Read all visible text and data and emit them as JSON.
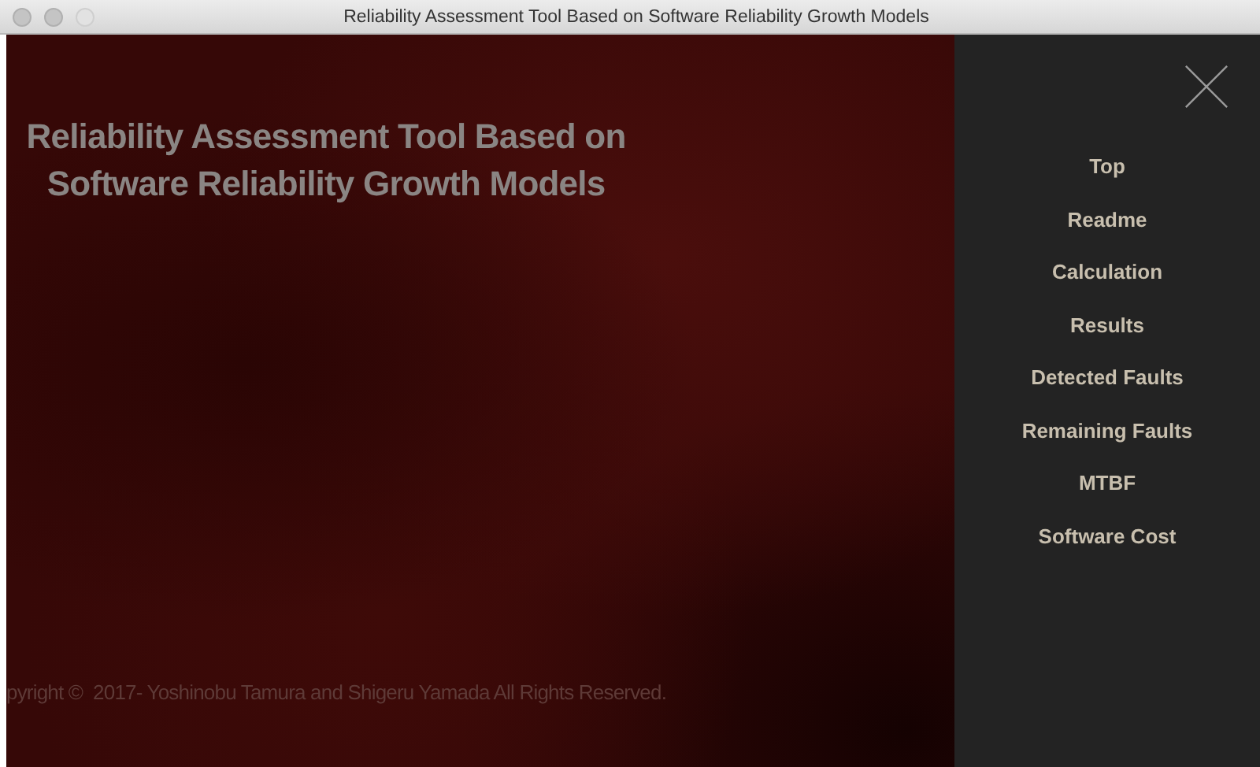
{
  "window": {
    "title": "Reliability Assessment Tool Based on Software Reliability Growth Models"
  },
  "heading": [
    "Reliability Assessment Tool Based on",
    "Software Reliability Growth Models"
  ],
  "footer": "pyright ©  2017- Yoshinobu Tamura and Shigeru Yamada All Rights Reserved.",
  "menu": {
    "items": [
      "Top",
      "Readme",
      "Calculation",
      "Results",
      "Detected Faults",
      "Remaining Faults",
      "MTBF",
      "Software Cost"
    ]
  }
}
